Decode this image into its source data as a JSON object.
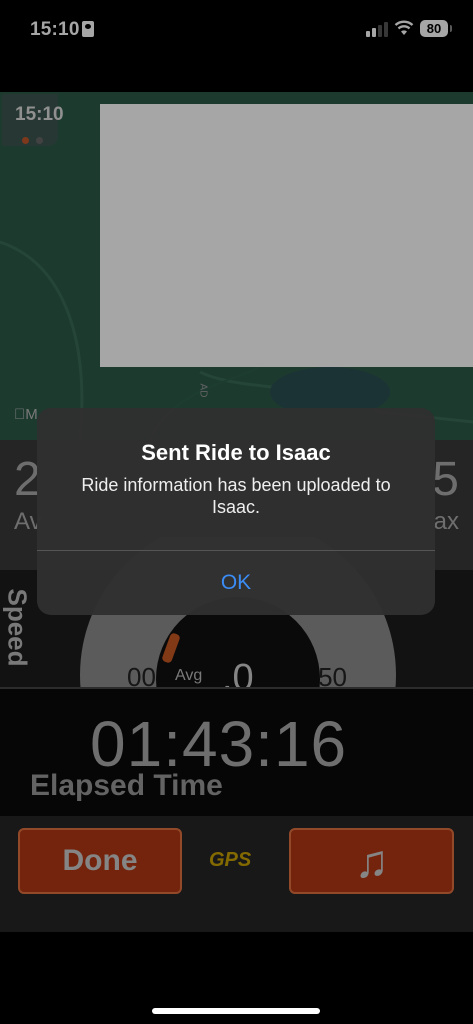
{
  "status_bar": {
    "time": "15:10",
    "battery": "80"
  },
  "map": {
    "clock": "15:10",
    "logo": "M",
    "road_label": "AD"
  },
  "stats": {
    "left_value": "2",
    "left_label": "Av",
    "right_value": "5",
    "right_label": "ax"
  },
  "gauge": {
    "side_label": "Speed",
    "min_tick": "00",
    "max_tick": "50",
    "avg_label": "Avg",
    "decimal": ".0"
  },
  "elapsed": {
    "value": "01:43:16",
    "label": "Elapsed Time"
  },
  "bottom": {
    "done_label": "Done",
    "gps_label": "GPS",
    "music_icon": "♫"
  },
  "alert": {
    "title": "Sent Ride to Isaac",
    "message": "Ride information has been uploaded to Isaac.",
    "ok_label": "OK"
  },
  "colors": {
    "accent_orange": "#b33814",
    "gps_yellow": "#c9a300",
    "ios_blue": "#3b8cf5"
  }
}
